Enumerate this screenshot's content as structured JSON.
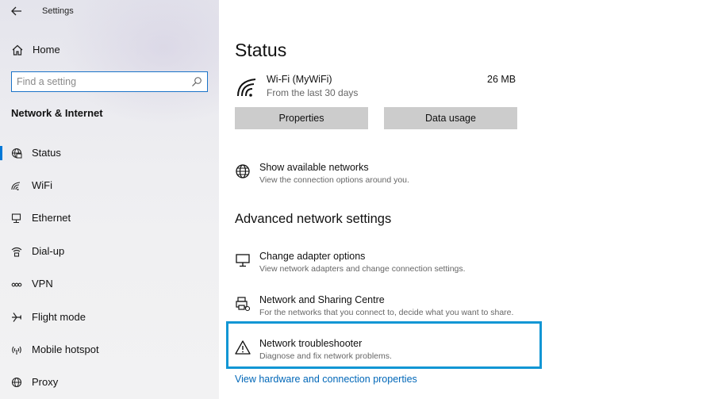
{
  "window": {
    "title": "Settings",
    "back_icon": "back-arrow-icon"
  },
  "sidebar": {
    "home_label": "Home",
    "home_icon": "home-icon",
    "search": {
      "placeholder": "Find a setting",
      "icon": "search-icon"
    },
    "section_heading": "Network & Internet",
    "items": [
      {
        "label": "Status",
        "icon": "globe-status-icon",
        "selected": true
      },
      {
        "label": "WiFi",
        "icon": "wifi-icon",
        "selected": false
      },
      {
        "label": "Ethernet",
        "icon": "ethernet-icon",
        "selected": false
      },
      {
        "label": "Dial-up",
        "icon": "dial-up-icon",
        "selected": false
      },
      {
        "label": "VPN",
        "icon": "vpn-icon",
        "selected": false
      },
      {
        "label": "Flight mode",
        "icon": "airplane-icon",
        "selected": false
      },
      {
        "label": "Mobile hotspot",
        "icon": "hotspot-icon",
        "selected": false
      },
      {
        "label": "Proxy",
        "icon": "globe-proxy-icon",
        "selected": false
      }
    ]
  },
  "main": {
    "title": "Status",
    "network": {
      "name": "Wi-Fi (MyWiFi)",
      "sub": "From the last 30 days",
      "usage": "26 MB",
      "icon": "wifi-signal-icon"
    },
    "buttons": {
      "properties": "Properties",
      "data_usage": "Data usage"
    },
    "show_networks": {
      "title": "Show available networks",
      "desc": "View the connection options around you.",
      "icon": "globe-icon"
    },
    "advanced_heading": "Advanced network settings",
    "adapter": {
      "title": "Change adapter options",
      "desc": "View network adapters and change connection settings.",
      "icon": "monitor-icon"
    },
    "sharing": {
      "title": "Network and Sharing Centre",
      "desc": "For the networks that you connect to, decide what you want to share.",
      "icon": "printer-share-icon"
    },
    "troubleshooter": {
      "title": "Network troubleshooter",
      "desc": "Diagnose and fix network problems.",
      "icon": "warning-icon",
      "highlighted": true
    },
    "link": "View hardware and connection properties"
  },
  "colors": {
    "accent": "#0078d7",
    "highlight_border": "#1296d4",
    "link": "#0067b8",
    "button_bg": "#cccccc"
  }
}
